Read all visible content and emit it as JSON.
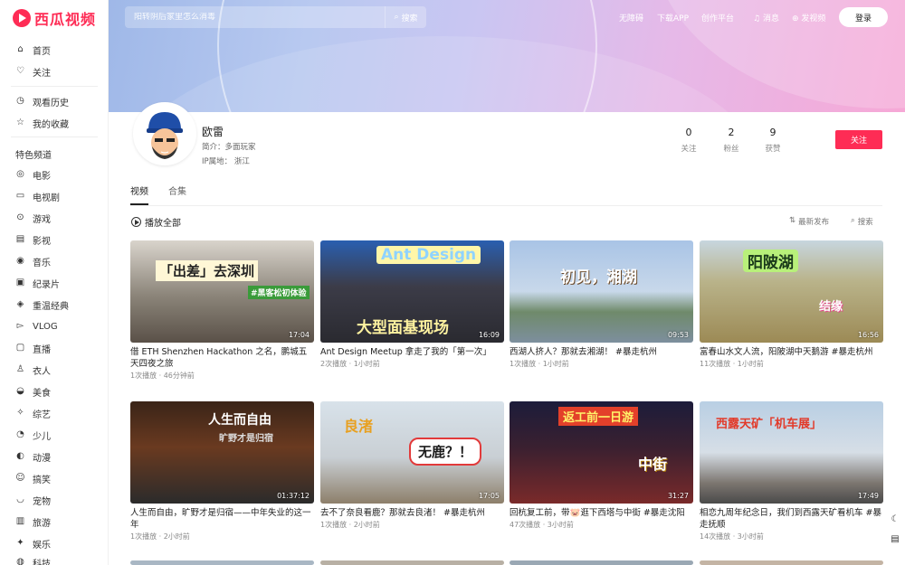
{
  "app": {
    "logo_text": "西瓜视频",
    "brand_color": "#fe2c55"
  },
  "sidebar": {
    "items": [
      {
        "label": "首页",
        "icon": "home-icon"
      },
      {
        "label": "关注",
        "icon": "heart-icon"
      },
      {
        "label": "观看历史",
        "icon": "history-icon"
      },
      {
        "label": "我的收藏",
        "icon": "star-icon"
      },
      {
        "label": "电影",
        "icon": "film-icon"
      },
      {
        "label": "电视剧",
        "icon": "tv-icon"
      },
      {
        "label": "游戏",
        "icon": "gamepad-icon"
      },
      {
        "label": "影视",
        "icon": "clapper-icon"
      },
      {
        "label": "音乐",
        "icon": "music-icon"
      },
      {
        "label": "纪录片",
        "icon": "documentary-icon"
      },
      {
        "label": "重温经典",
        "icon": "classic-icon"
      },
      {
        "label": "VLOG",
        "icon": "vlog-icon"
      },
      {
        "label": "直播",
        "icon": "live-icon"
      },
      {
        "label": "衣人",
        "icon": "shirt-icon"
      },
      {
        "label": "美食",
        "icon": "food-icon"
      },
      {
        "label": "综艺",
        "icon": "variety-icon"
      },
      {
        "label": "少儿",
        "icon": "kids-icon"
      },
      {
        "label": "动漫",
        "icon": "anime-icon"
      },
      {
        "label": "搞笑",
        "icon": "smile-icon"
      },
      {
        "label": "宠物",
        "icon": "pet-icon"
      },
      {
        "label": "旅游",
        "icon": "travel-icon"
      },
      {
        "label": "娱乐",
        "icon": "entertainment-icon"
      },
      {
        "label": "科技",
        "icon": "tech-icon"
      }
    ],
    "section_heading": "特色频道"
  },
  "topbar": {
    "search_placeholder": "阳转阴后家里怎么消毒",
    "search_button": "搜索",
    "links": [
      "无障碍",
      "下载APP",
      "创作平台"
    ],
    "messages": "消息",
    "publish": "发视频",
    "login": "登录"
  },
  "profile": {
    "name": "欧雷",
    "intro_label": "简介：",
    "intro": "多面玩家",
    "ip_label": "IP属地：",
    "ip": "浙江",
    "stats": [
      {
        "num": "0",
        "label": "关注"
      },
      {
        "num": "2",
        "label": "粉丝"
      },
      {
        "num": "9",
        "label": "获赞"
      }
    ],
    "follow": "关注"
  },
  "tabs": [
    {
      "label": "视频",
      "active": true
    },
    {
      "label": "合集",
      "active": false
    }
  ],
  "list_controls": {
    "play_all": "播放全部",
    "sort": "最新发布",
    "search": "搜索"
  },
  "videos": [
    {
      "title": "借 ETH Shenzhen Hackathon 之名，鹏城五天四夜之旅",
      "meta": "1次播放 · 46分钟前",
      "duration": "17:04",
      "overlay": "「出差」去深圳",
      "overlay2": "#黑客松初体验"
    },
    {
      "title": "Ant Design Meetup 拿走了我的「第一次」",
      "meta": "2次播放 · 1小时前",
      "duration": "16:09",
      "overlay": "Ant Design",
      "overlay2": "大型面基现场"
    },
    {
      "title": "西湖人挤人？那就去湘湖！ #暴走杭州",
      "meta": "1次播放 · 1小时前",
      "duration": "09:53",
      "overlay": "初见，湘湖",
      "overlay2": ""
    },
    {
      "title": "富春山水文人流，阳陂湖中天鹅游 #暴走杭州",
      "meta": "11次播放 · 1小时前",
      "duration": "16:56",
      "overlay": "阳陂湖",
      "overlay2": "结缘"
    },
    {
      "title": "人生而自由，旷野才是归宿——中年失业的这一年",
      "meta": "1次播放 · 2小时前",
      "duration": "01:37:12",
      "overlay": "人生而自由",
      "overlay2": "旷野才是归宿"
    },
    {
      "title": "去不了奈良看鹿？那就去良渚！ #暴走杭州",
      "meta": "1次播放 · 2小时前",
      "duration": "17:05",
      "overlay": "良渚",
      "overlay2": "无鹿？！"
    },
    {
      "title": "回杭复工前，带🐷逛下西塔与中街 #暴走沈阳",
      "meta": "47次播放 · 3小时前",
      "duration": "31:27",
      "overlay": "返工前一日游",
      "overlay2": "中街"
    },
    {
      "title": "相恋九周年纪念日，我们到西露天矿看机车 #暴走抚顺",
      "meta": "14次播放 · 3小时前",
      "duration": "17:49",
      "overlay": "西露天矿「机车展」",
      "overlay2": ""
    }
  ]
}
